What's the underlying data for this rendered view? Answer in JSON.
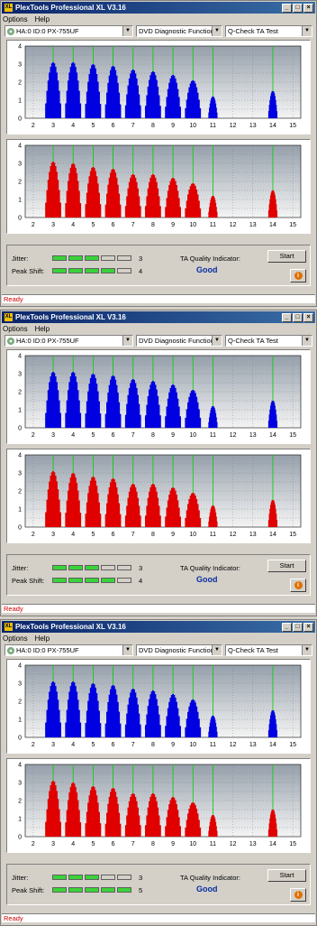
{
  "app": {
    "title": "PlexTools Professional XL V3.16",
    "logo_text": "XL"
  },
  "menu": {
    "options": "Options",
    "help": "Help"
  },
  "drive_select": {
    "value": "HA:0 ID:0  PX-755UF"
  },
  "function_select": {
    "value": "DVD Diagnostic Functions"
  },
  "test_select": {
    "value": "Q-Check TA Test"
  },
  "labels": {
    "jitter": "Jitter:",
    "peak_shift": "Peak Shift:",
    "ta_quality": "TA Quality Indicator:",
    "start": "Start",
    "info": "i"
  },
  "windows": [
    {
      "jitter_value": "3",
      "jitter_level": 3,
      "peak_shift_value": "4",
      "peak_shift_level": 4,
      "quality": "Good",
      "status": "Ready"
    },
    {
      "jitter_value": "3",
      "jitter_level": 3,
      "peak_shift_value": "4",
      "peak_shift_level": 4,
      "quality": "Good",
      "status": "Ready"
    },
    {
      "jitter_value": "3",
      "jitter_level": 3,
      "peak_shift_value": "5",
      "peak_shift_level": 5,
      "quality": "Good",
      "status": "Ready"
    }
  ],
  "meter_segments": 5,
  "colors": {
    "top_series": "#0000e0",
    "bottom_series": "#e00000",
    "marker_line": "#00d000",
    "quality": "#0a2fa0",
    "status": "#d00000"
  },
  "chart_data": {
    "type": "bar",
    "title": "",
    "xlabel": "",
    "ylabel": "",
    "x_ticks": [
      "2",
      "3",
      "4",
      "5",
      "6",
      "7",
      "8",
      "9",
      "10",
      "11",
      "12",
      "13",
      "14",
      "15"
    ],
    "y_ticks": [
      "0",
      "0.5",
      "1",
      "1.5",
      "2",
      "2.5",
      "3",
      "3.5",
      "4"
    ],
    "xlim": [
      1.6,
      15.4
    ],
    "ylim": [
      0,
      4
    ],
    "marker_lines_x": [
      3,
      4,
      5,
      6,
      7,
      8,
      9,
      10,
      11,
      14
    ],
    "charts": [
      {
        "panel": "top",
        "series": [
          {
            "x": [
              3,
              4,
              5,
              6,
              7,
              8,
              9,
              10,
              11,
              14
            ],
            "peak": [
              3.1,
              3.1,
              3.0,
              2.9,
              2.7,
              2.6,
              2.4,
              2.1,
              1.2,
              1.5
            ]
          }
        ]
      },
      {
        "panel": "bottom",
        "series": [
          {
            "x": [
              3,
              4,
              5,
              6,
              7,
              8,
              9,
              10,
              11,
              14
            ],
            "peak": [
              3.1,
              3.0,
              2.8,
              2.7,
              2.4,
              2.4,
              2.2,
              1.9,
              1.2,
              1.5
            ]
          }
        ]
      }
    ]
  }
}
